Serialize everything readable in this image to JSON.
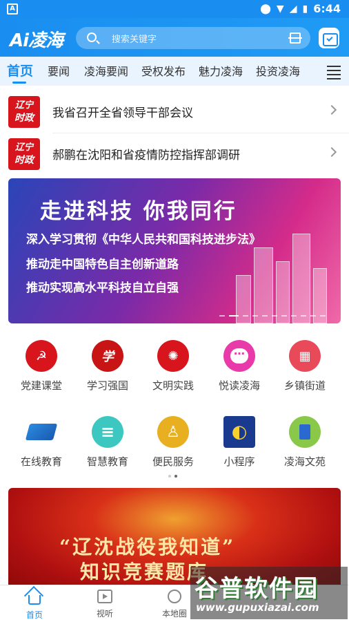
{
  "status_bar": {
    "time": "6:44",
    "left_icon": "A"
  },
  "header": {
    "logo": "Ai凌海",
    "search_placeholder": "搜索关键字"
  },
  "tabs": [
    {
      "label": "首页",
      "active": true
    },
    {
      "label": "要闻",
      "active": false
    },
    {
      "label": "凌海要闻",
      "active": false
    },
    {
      "label": "受权发布",
      "active": false
    },
    {
      "label": "魅力凌海",
      "active": false
    },
    {
      "label": "投资凌海",
      "active": false
    }
  ],
  "news": [
    {
      "badge_top": "辽宁",
      "badge_bottom": "时政",
      "title": "我省召开全省领导干部会议"
    },
    {
      "badge_top": "辽宁",
      "badge_bottom": "时政",
      "title": "郝鹏在沈阳和省疫情防控指挥部调研"
    }
  ],
  "banner": {
    "title": "走进科技  你我同行",
    "lines": [
      "深入学习贯彻《中华人民共和国科技进步法》",
      "推动走中国特色自主创新道路",
      "推动实现高水平科技自立自强"
    ]
  },
  "grid": [
    {
      "label": "党建课堂",
      "icon": "party-icon",
      "glyph": "☭",
      "color": "#d8141c"
    },
    {
      "label": "学习强国",
      "icon": "xuexi-icon",
      "glyph": "学",
      "color": "#c81414"
    },
    {
      "label": "文明实践",
      "icon": "civilization-icon",
      "glyph": "✺",
      "color": "#d8141c"
    },
    {
      "label": "悦读凌海",
      "icon": "chat-icon",
      "glyph": "⋯",
      "color": "#e83aa8"
    },
    {
      "label": "乡镇街道",
      "icon": "building-icon",
      "glyph": "▦",
      "color": "#e84a5a"
    },
    {
      "label": "在线教育",
      "icon": "laptop-icon",
      "glyph": "▭",
      "color": "#ffffff"
    },
    {
      "label": "智慧教育",
      "icon": "books-icon",
      "glyph": "≡",
      "color": "#3cc8c0"
    },
    {
      "label": "便民服务",
      "icon": "person-icon",
      "glyph": "♙",
      "color": "#e8b020"
    },
    {
      "label": "小程序",
      "icon": "miniapp-icon",
      "glyph": "◐",
      "color": "#1a4ab0"
    },
    {
      "label": "凌海文苑",
      "icon": "book-icon",
      "glyph": "▮",
      "color": "#8ac84a"
    }
  ],
  "bottom_banner": {
    "line1": "“辽沈战役我知道”",
    "line2": "知识竞赛题库"
  },
  "bottom_nav": [
    {
      "label": "首页",
      "icon": "home-icon",
      "active": true
    },
    {
      "label": "视听",
      "icon": "tv-icon",
      "active": false
    },
    {
      "label": "本地圈",
      "icon": "map-icon",
      "active": false
    }
  ],
  "watermark": {
    "brand": "谷普软件园",
    "url": "www.gupuxiazai.com"
  },
  "colors": {
    "primary": "#1a8ef0",
    "news_badge": "#d8141c"
  }
}
